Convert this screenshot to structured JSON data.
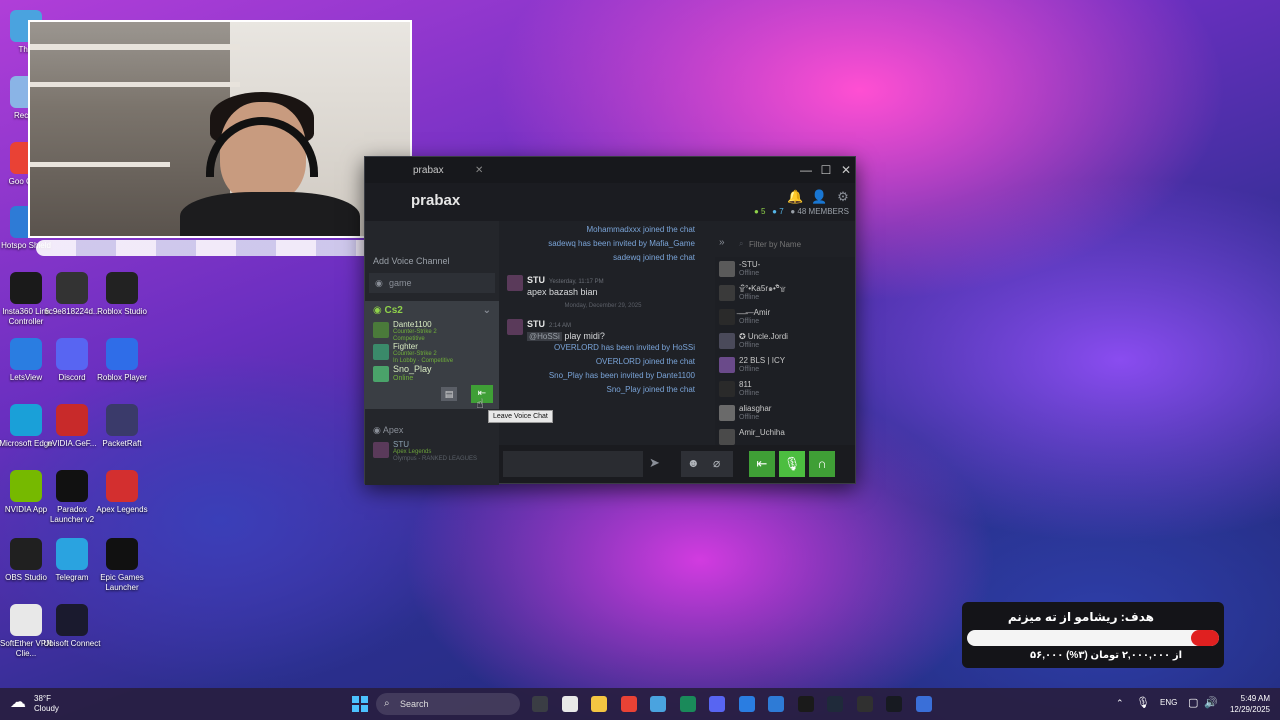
{
  "desktop_icons": [
    {
      "label": "This",
      "color": "#4aa3df"
    },
    {
      "label": "Recycl",
      "color": "#8ab4e6"
    },
    {
      "label": "Goo Chro",
      "color": "#e94235"
    },
    {
      "label": "Hotspo Shield",
      "color": "#2e7bd6"
    },
    {
      "label": "Insta360 Link Controller",
      "color": "#1a1a1a"
    },
    {
      "label": "6c9e818224d...",
      "color": "#333333"
    },
    {
      "label": "Roblox Studio",
      "color": "#222222"
    },
    {
      "label": "LetsView",
      "color": "#2a7de1"
    },
    {
      "label": "Discord",
      "color": "#5865f2"
    },
    {
      "label": "Roblox Player",
      "color": "#2f6de8"
    },
    {
      "label": "Microsoft Edge",
      "color": "#1aa0d8"
    },
    {
      "label": "nVIDIA.GeF...",
      "color": "#c82a2a"
    },
    {
      "label": "PacketRaft",
      "color": "#3a3a6a"
    },
    {
      "label": "NVIDIA App",
      "color": "#76b900"
    },
    {
      "label": "Paradox Launcher v2",
      "color": "#111111"
    },
    {
      "label": "Apex Legends",
      "color": "#d32f2f"
    },
    {
      "label": "OBS Studio",
      "color": "#202020"
    },
    {
      "label": "Telegram",
      "color": "#2aa3e0"
    },
    {
      "label": "Epic Games Launcher",
      "color": "#111111"
    },
    {
      "label": "SoftEther VPN Clie...",
      "color": "#e8e8e8"
    },
    {
      "label": "Ubisoft Connect",
      "color": "#1a1a2e"
    }
  ],
  "steam": {
    "tab_label": "prabax",
    "group_name": "prabax",
    "counts": {
      "ingame": "5",
      "online": "7",
      "members": "48 MEMBERS"
    },
    "left": {
      "add_voice": "Add Voice Channel",
      "game_channel": "game",
      "cs2": {
        "title": "Cs2",
        "members": [
          {
            "name": "Dante1100",
            "game": "Counter-Strike 2",
            "status": "Competitive",
            "color": "#4a7a3a"
          },
          {
            "name": "Fighter",
            "game": "Counter-Strike 2",
            "status": "In Lobby · Competitive",
            "color": "#3a8a6a"
          },
          {
            "name": "Sno_Play",
            "game": "Online",
            "status": "",
            "color": "#4aa36a"
          }
        ]
      },
      "apex": {
        "title": "Apex",
        "member": {
          "name": "STU",
          "game": "Apex Legends",
          "status": "Olympus - RANKED LEAGUES",
          "color": "#5a3a5a"
        }
      }
    },
    "chat": {
      "system_top": [
        "Mohammadxxx joined the chat",
        "sadewq has been invited by Mafia_Game",
        "sadewq joined the chat"
      ],
      "msg1": {
        "author": "STU",
        "time": "Yesterday, 11:17 PM",
        "text": "apex bazash bian"
      },
      "date_sep": "Monday, December 29, 2025",
      "msg2": {
        "author": "STU",
        "time": "2:14 AM",
        "mention": "@HoSSi",
        "text": "play midi?"
      },
      "system_bottom": [
        "OVERLORD has been invited by HoSSi",
        "OVERLORD joined the chat",
        "Sno_Play has been invited by Dante1100",
        "Sno_Play joined the chat"
      ]
    },
    "friends_filter_placeholder": "Filter by Name",
    "friends": [
      {
        "name": "-STU-",
        "status": "Offline",
        "color": "#5a5a5a"
      },
      {
        "name": "۩ิ°•Ka5r๑•°ิ۩",
        "status": "Offline",
        "color": "#3a3a3a"
      },
      {
        "name": "̶ ̶ ̶ ̶—Amir",
        "status": "Offline",
        "color": "#2a2a2a"
      },
      {
        "name": "✪ Uncle.Jordi",
        "status": "Offline",
        "color": "#4a4a5a"
      },
      {
        "name": "22 BLS | ICY",
        "status": "Offline",
        "color": "#6a4a8a"
      },
      {
        "name": "811",
        "status": "Offline",
        "color": "#2a2a2a"
      },
      {
        "name": "aliasghar",
        "status": "Offline",
        "color": "#6a6a6a"
      },
      {
        "name": "Amir_Uchiha",
        "status": "",
        "color": "#4a4a4a"
      }
    ],
    "tooltip": "Leave Voice Chat"
  },
  "donation": {
    "title": "هدف: ریشامو از ته میزنم",
    "amount": "۵۶,۰۰۰ از ۲,۰۰۰,۰۰۰ تومان (۳%)",
    "progress": 0.03
  },
  "taskbar": {
    "weather_temp": "38°F",
    "weather_desc": "Cloudy",
    "search_placeholder": "Search",
    "lang": "ENG",
    "time": "5:49 AM",
    "date": "12/29/2025"
  }
}
